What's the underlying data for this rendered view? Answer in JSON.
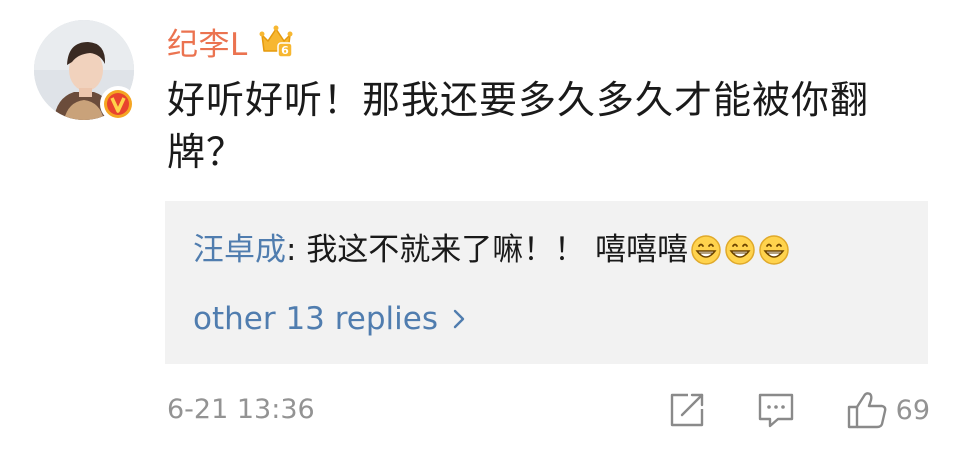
{
  "comment": {
    "username": "纪李L",
    "text": "好听好听！那我还要多久多久才能被你翻牌？",
    "timestamp": "6-21 13:36",
    "likes": "69",
    "vip_level": "6"
  },
  "reply_preview": {
    "author": "汪卓成",
    "separator": ": ",
    "text": "我这不就来了嘛！！ 嘻嘻嘻",
    "emojis": [
      "grin-emoji",
      "grin-emoji",
      "grin-emoji"
    ]
  },
  "more_replies_label": "other 13 replies",
  "colors": {
    "username": "#eb7350",
    "link": "#507daf",
    "muted": "#939393",
    "reply_bg": "#f2f2f2"
  }
}
